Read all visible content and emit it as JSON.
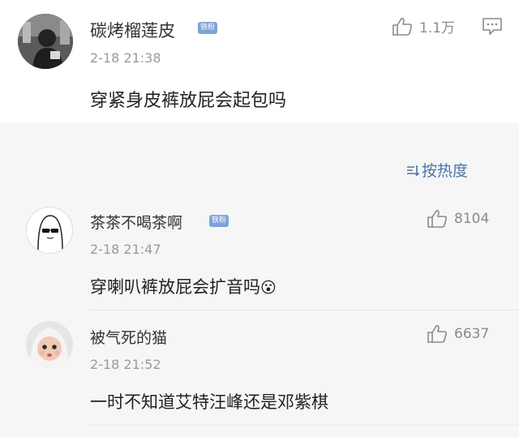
{
  "main_post": {
    "username": "碳烤榴莲皮",
    "badge": "铁粉",
    "time": "2-18 21:38",
    "content": "穿紧身皮裤放屁会起包吗",
    "likes": "1.1万"
  },
  "sort": {
    "label": "按热度"
  },
  "comments": [
    {
      "username": "茶茶不喝茶啊",
      "badge": "铁粉",
      "time": "2-18 21:47",
      "content": "穿喇叭裤放屁会扩音吗",
      "emoji": "😮",
      "likes": "8104"
    },
    {
      "username": "被气死的猫",
      "time": "2-18 21:52",
      "content": "一时不知道艾特汪峰还是邓紫棋",
      "likes": "6637"
    }
  ],
  "icons": {
    "like": "thumbs-up-icon",
    "comment": "comment-icon",
    "sort": "sort-icon"
  }
}
